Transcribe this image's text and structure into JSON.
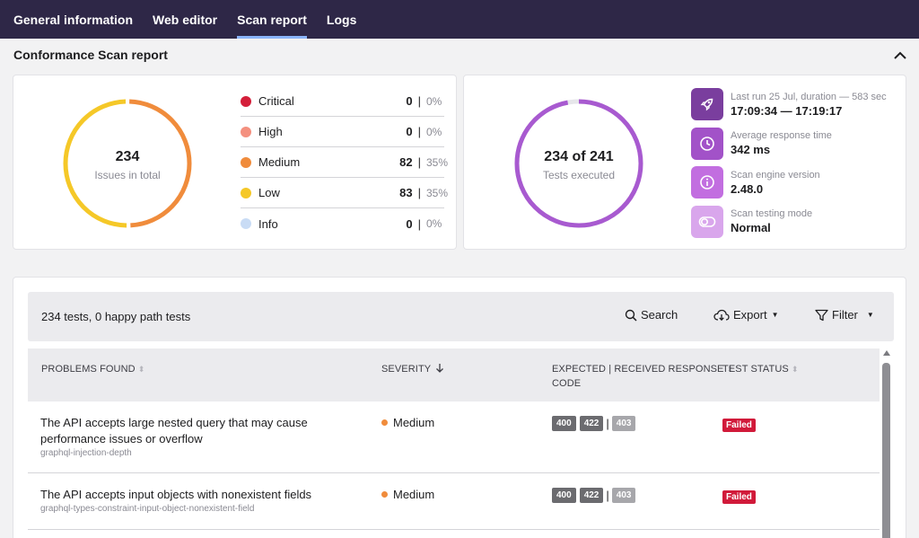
{
  "tabs": [
    {
      "label": "General information"
    },
    {
      "label": "Web editor"
    },
    {
      "label": "Scan report"
    },
    {
      "label": "Logs"
    }
  ],
  "active_tab": "Scan report",
  "section": {
    "title": "Conformance Scan report"
  },
  "issues": {
    "total": "234",
    "total_label": "Issues in total",
    "severities": [
      {
        "label": "Critical",
        "count": "0",
        "pct": "0%",
        "color": "#d41f3a"
      },
      {
        "label": "High",
        "count": "0",
        "pct": "0%",
        "color": "#f4907f"
      },
      {
        "label": "Medium",
        "count": "82",
        "pct": "35%",
        "color": "#f08c3c"
      },
      {
        "label": "Low",
        "count": "83",
        "pct": "35%",
        "color": "#f5c828"
      },
      {
        "label": "Info",
        "count": "0",
        "pct": "0%",
        "color": "#c9dcf5"
      }
    ]
  },
  "tests": {
    "executed_text": "234 of 241",
    "executed_label": "Tests executed",
    "executed": 234,
    "total": 241,
    "ring_color": "#a85ad0",
    "meta": [
      {
        "icon": "rocket-icon",
        "label": "Last run 25 Jul, duration — 583 sec",
        "value": "17:09:34 — 17:19:17",
        "color": "#7a3e9e"
      },
      {
        "icon": "clock-icon",
        "label": "Average response time",
        "value": "342 ms",
        "color": "#a252c8"
      },
      {
        "icon": "info-icon",
        "label": "Scan engine version",
        "value": "2.48.0",
        "color": "#c26ee0"
      },
      {
        "icon": "toggle-icon",
        "label": "Scan testing mode",
        "value": "Normal",
        "color": "#d9a6ec"
      }
    ]
  },
  "toolbar": {
    "summary": "234 tests, 0 happy path tests",
    "search_label": "Search",
    "export_label": "Export",
    "filter_label": "Filter"
  },
  "table": {
    "headers": {
      "problems": "PROBLEMS FOUND",
      "severity": "SEVERITY",
      "response_line1": "EXPECTED | RECEIVED RESPONSE",
      "response_line2": "CODE",
      "status": "TEST STATUS"
    },
    "rows": [
      {
        "title_line1": "The API accepts large nested query that may cause",
        "title_line2": "performance issues or overflow",
        "code": "graphql-injection-depth",
        "severity": "Medium",
        "expected": [
          "400",
          "422"
        ],
        "received": "403",
        "status": "Failed"
      },
      {
        "title_line1": "The API accepts input objects with nonexistent fields",
        "title_line2": "",
        "code": "graphql-types-constraint-input-object-nonexistent-field",
        "severity": "Medium",
        "expected": [
          "400",
          "422"
        ],
        "received": "403",
        "status": "Failed"
      }
    ]
  }
}
